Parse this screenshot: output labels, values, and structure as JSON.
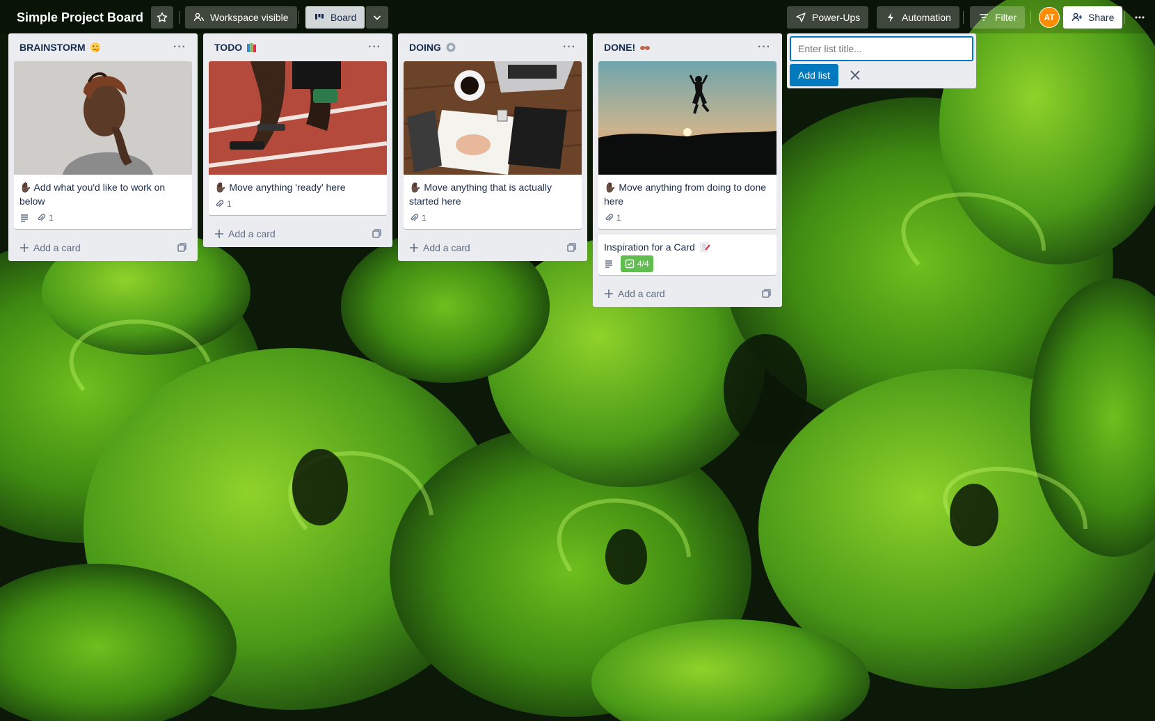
{
  "board": {
    "title": "Simple Project Board",
    "visibility_label": "Workspace visible",
    "view_label": "Board"
  },
  "header_right": {
    "powerups_label": "Power-Ups",
    "automation_label": "Automation",
    "filter_label": "Filter",
    "avatar_initials": "AT",
    "share_label": "Share"
  },
  "lists": [
    {
      "title": "BRAINSTORM",
      "emoji": "thinking-face-icon",
      "card": {
        "text": "✋🏿 Add what you'd like to work on below",
        "attachments": "1",
        "has_description": true
      },
      "add_card_label": "Add a card"
    },
    {
      "title": "TODO",
      "emoji": "books-icon",
      "card": {
        "text": "✋🏿 Move anything 'ready' here",
        "attachments": "1",
        "has_description": false
      },
      "add_card_label": "Add a card"
    },
    {
      "title": "DOING",
      "emoji": "gear-icon",
      "card": {
        "text": "✋🏿 Move anything that is actually started here",
        "attachments": "1",
        "has_description": false
      },
      "add_card_label": "Add a card"
    },
    {
      "title": "DONE!",
      "emoji": "sunglasses-icon",
      "card": {
        "text": "✋🏿 Move anything from doing to done here",
        "attachments": "1",
        "has_description": false
      },
      "card2": {
        "text": "Inspiration for a Card",
        "emoji": "memo-icon",
        "checklist": "4/4",
        "has_description": true
      },
      "add_card_label": "Add a card"
    }
  ],
  "add_list": {
    "placeholder": "Enter list title...",
    "button_label": "Add list"
  },
  "colors": {
    "accent": "#0079bf",
    "checklist_done": "#61bd4f",
    "avatar": "#ff8b00",
    "list_bg": "#ebecf0"
  }
}
